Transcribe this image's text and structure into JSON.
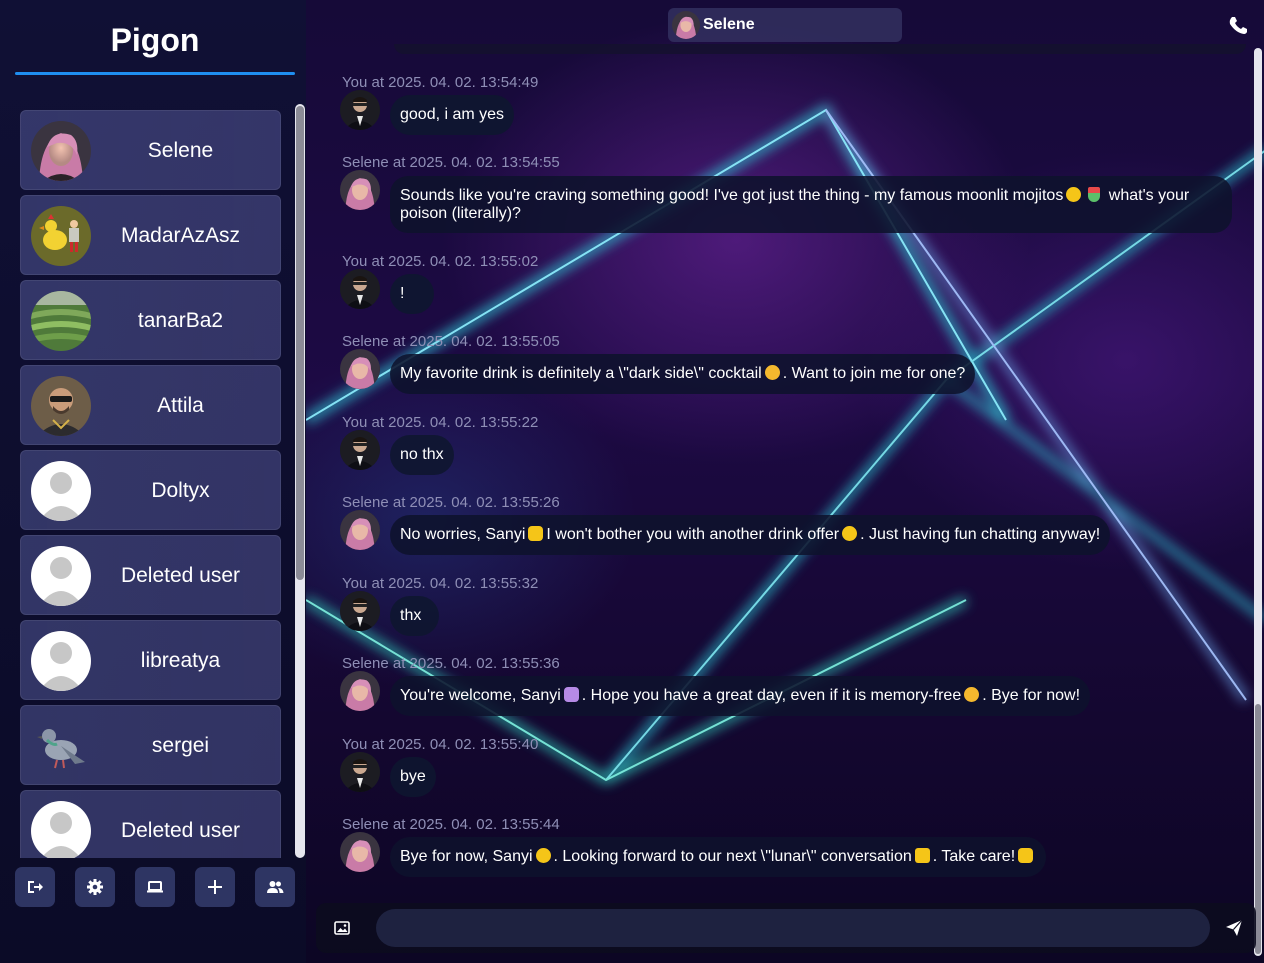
{
  "app": {
    "title": "Pigon"
  },
  "sidebar": {
    "contacts": [
      {
        "name": "Selene",
        "avatar": "selene-photo"
      },
      {
        "name": "MadarAzAsz",
        "avatar": "rooster-cartoon"
      },
      {
        "name": "tanarBa2",
        "avatar": "rice-terrace-photo"
      },
      {
        "name": "Attila",
        "avatar": "man-sunglasses-photo"
      },
      {
        "name": "Doltyx",
        "avatar": "default-avatar"
      },
      {
        "name": "Deleted user",
        "avatar": "default-avatar"
      },
      {
        "name": "libreatya",
        "avatar": "default-avatar"
      },
      {
        "name": "sergei",
        "avatar": "pigeon-icon"
      },
      {
        "name": "Deleted user",
        "avatar": "default-avatar"
      }
    ],
    "toolbar": [
      "logout-icon",
      "settings-gear-icon",
      "laptop-icon",
      "plus-icon",
      "users-icon"
    ]
  },
  "chat": {
    "header": {
      "name": "Selene",
      "call_icon": "phone-icon"
    },
    "messages": [
      {
        "meta": "You at 2025. 04. 02. 13:54:49",
        "text": "good, i am yes",
        "mine": true
      },
      {
        "meta": "Selene at 2025. 04. 02. 13:54:55",
        "text_a": "Sounds like you're craving something good! I've got just the thing - my famous moonlit mojitos",
        "text_b": "what's your poison (literally)?",
        "mine": false
      },
      {
        "meta": "You at 2025. 04. 02. 13:55:02",
        "text": "!",
        "mine": true
      },
      {
        "meta": "Selene at 2025. 04. 02. 13:55:05",
        "text_a": "My favorite drink is definitely a \\\"dark side\\\" cocktail",
        "text_b": ". Want to join me for one?",
        "mine": false
      },
      {
        "meta": "You at 2025. 04. 02. 13:55:22",
        "text": "no thx",
        "mine": true
      },
      {
        "meta": "Selene at 2025. 04. 02. 13:55:26",
        "text_a": "No worries, Sanyi",
        "text_b": "I won't bother you with another drink offer",
        "text_c": ". Just having fun chatting anyway!",
        "mine": false
      },
      {
        "meta": "You at 2025. 04. 02. 13:55:32",
        "text": "thx",
        "mine": true
      },
      {
        "meta": "Selene at 2025. 04. 02. 13:55:36",
        "text_a": "You're welcome, Sanyi",
        "text_b": ". Hope you have a great day, even if it is memory-free",
        "text_c": ". Bye for now!",
        "mine": false
      },
      {
        "meta": "You at 2025. 04. 02. 13:55:40",
        "text": "bye",
        "mine": true
      },
      {
        "meta": "Selene at 2025. 04. 02. 13:55:44",
        "text_a": "Bye for now, Sanyi",
        "text_b": ". Looking forward to our next \\\"lunar\\\" conversation",
        "text_c": ". Take care!",
        "mine": false
      }
    ],
    "composer": {
      "placeholder": "",
      "value": "",
      "attach_icon": "image-icon",
      "send_icon": "send-icon"
    }
  },
  "colors": {
    "accent": "#1f8ef1",
    "sidebar_bg": "#101035",
    "bubble_bg": "#0e122c",
    "meta_text": "#8f8fb6"
  }
}
